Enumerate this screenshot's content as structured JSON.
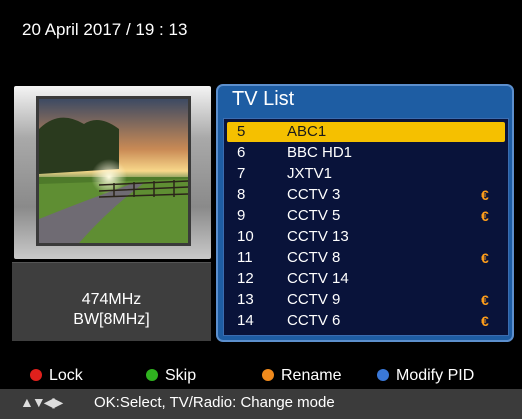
{
  "header": {
    "datetime": "20 April 2017 / 19 : 13"
  },
  "preview": {
    "frequency": "474MHz",
    "bandwidth": "BW[8MHz]"
  },
  "tv_list": {
    "title": "TV List",
    "selected_index": 0,
    "channels": [
      {
        "num": "5",
        "name": "ABC1",
        "scrambled": false
      },
      {
        "num": "6",
        "name": "BBC HD1",
        "scrambled": false
      },
      {
        "num": "7",
        "name": "JXTV1",
        "scrambled": false
      },
      {
        "num": "8",
        "name": "CCTV 3",
        "scrambled": true
      },
      {
        "num": "9",
        "name": "CCTV 5",
        "scrambled": true
      },
      {
        "num": "10",
        "name": "CCTV 13",
        "scrambled": false
      },
      {
        "num": "11",
        "name": "CCTV 8",
        "scrambled": true
      },
      {
        "num": "12",
        "name": "CCTV 14",
        "scrambled": false
      },
      {
        "num": "13",
        "name": "CCTV 9",
        "scrambled": true
      },
      {
        "num": "14",
        "name": "CCTV 6",
        "scrambled": true
      }
    ],
    "scrambled_symbol": "€"
  },
  "legend": {
    "lock": {
      "label": "Lock",
      "color": "#e0201c"
    },
    "skip": {
      "label": "Skip",
      "color": "#2fb21f"
    },
    "rename": {
      "label": "Rename",
      "color": "#f08a1c"
    },
    "modify": {
      "label": "Modify PID",
      "color": "#3a78d8"
    }
  },
  "help": {
    "arrows": "▲▼◀▶",
    "text": "OK:Select, TV/Radio: Change mode"
  }
}
